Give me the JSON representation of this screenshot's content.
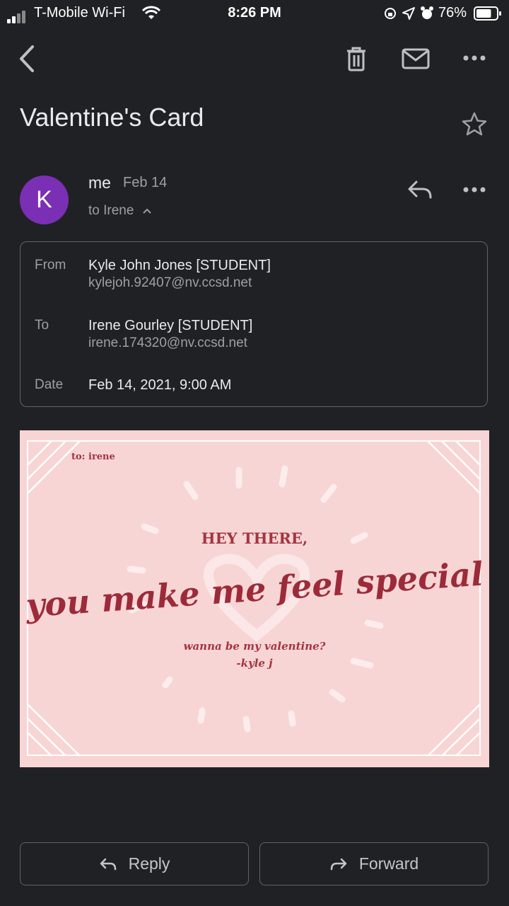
{
  "status_bar": {
    "carrier": "T-Mobile Wi-Fi",
    "time": "8:26 PM",
    "battery": "76%",
    "battery_level": 0.76
  },
  "toolbar": {
    "back_icon": "chevron-left-icon",
    "trash_icon": "trash-icon",
    "mail_icon": "mail-icon",
    "more_icon": "more-horizontal-icon"
  },
  "email": {
    "subject": "Valentine's Card",
    "avatar_letter": "K",
    "avatar_color": "#7b2fb5",
    "sender": "me",
    "date_short": "Feb 14",
    "to_line": "to Irene",
    "details": {
      "from_label": "From",
      "from_name": "Kyle John Jones [STUDENT]",
      "from_email": "kylejoh.92407@nv.ccsd.net",
      "to_label": "To",
      "to_name": "Irene Gourley [STUDENT]",
      "to_email": "irene.174320@nv.ccsd.net",
      "date_label": "Date",
      "date_full": "Feb 14, 2021, 9:00 AM"
    }
  },
  "card": {
    "to": "to: irene",
    "headline": "HEY THERE,",
    "main": "you make me feel special",
    "question": "wanna be my valentine?",
    "signature": "-kyle j",
    "bg_color": "#f7d5d5",
    "text_color": "#a33440"
  },
  "actions": {
    "reply": "Reply",
    "forward": "Forward"
  }
}
